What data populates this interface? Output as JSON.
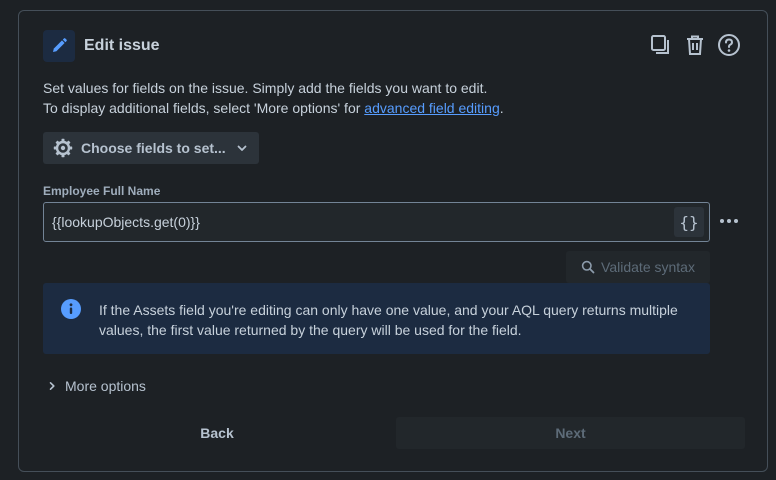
{
  "header": {
    "title": "Edit issue",
    "icon": "pencil-icon",
    "actions": [
      "duplicate-icon",
      "trash-icon",
      "help-icon"
    ]
  },
  "description": {
    "line1": "Set values for fields on the issue. Simply add the fields you want to edit.",
    "line2_prefix": "To display additional fields, select 'More options' for ",
    "line2_link": "advanced field editing",
    "line2_suffix": "."
  },
  "choose_fields": {
    "label": "Choose fields to set..."
  },
  "field": {
    "label": "Employee Full Name",
    "value": "{{lookupObjects.get(0)}}",
    "smart_value_button": "{}"
  },
  "validate": {
    "label": "Validate syntax"
  },
  "info": {
    "text": "If the Assets field you're editing can only have one value, and your AQL query returns multiple values, the first value returned by the query will be used for the field."
  },
  "more_options": {
    "label": "More options"
  },
  "footer": {
    "back_label": "Back",
    "next_label": "Next"
  },
  "colors": {
    "background": "#1d2125",
    "accent": "#579dff",
    "info_bg": "#1c2b41"
  }
}
